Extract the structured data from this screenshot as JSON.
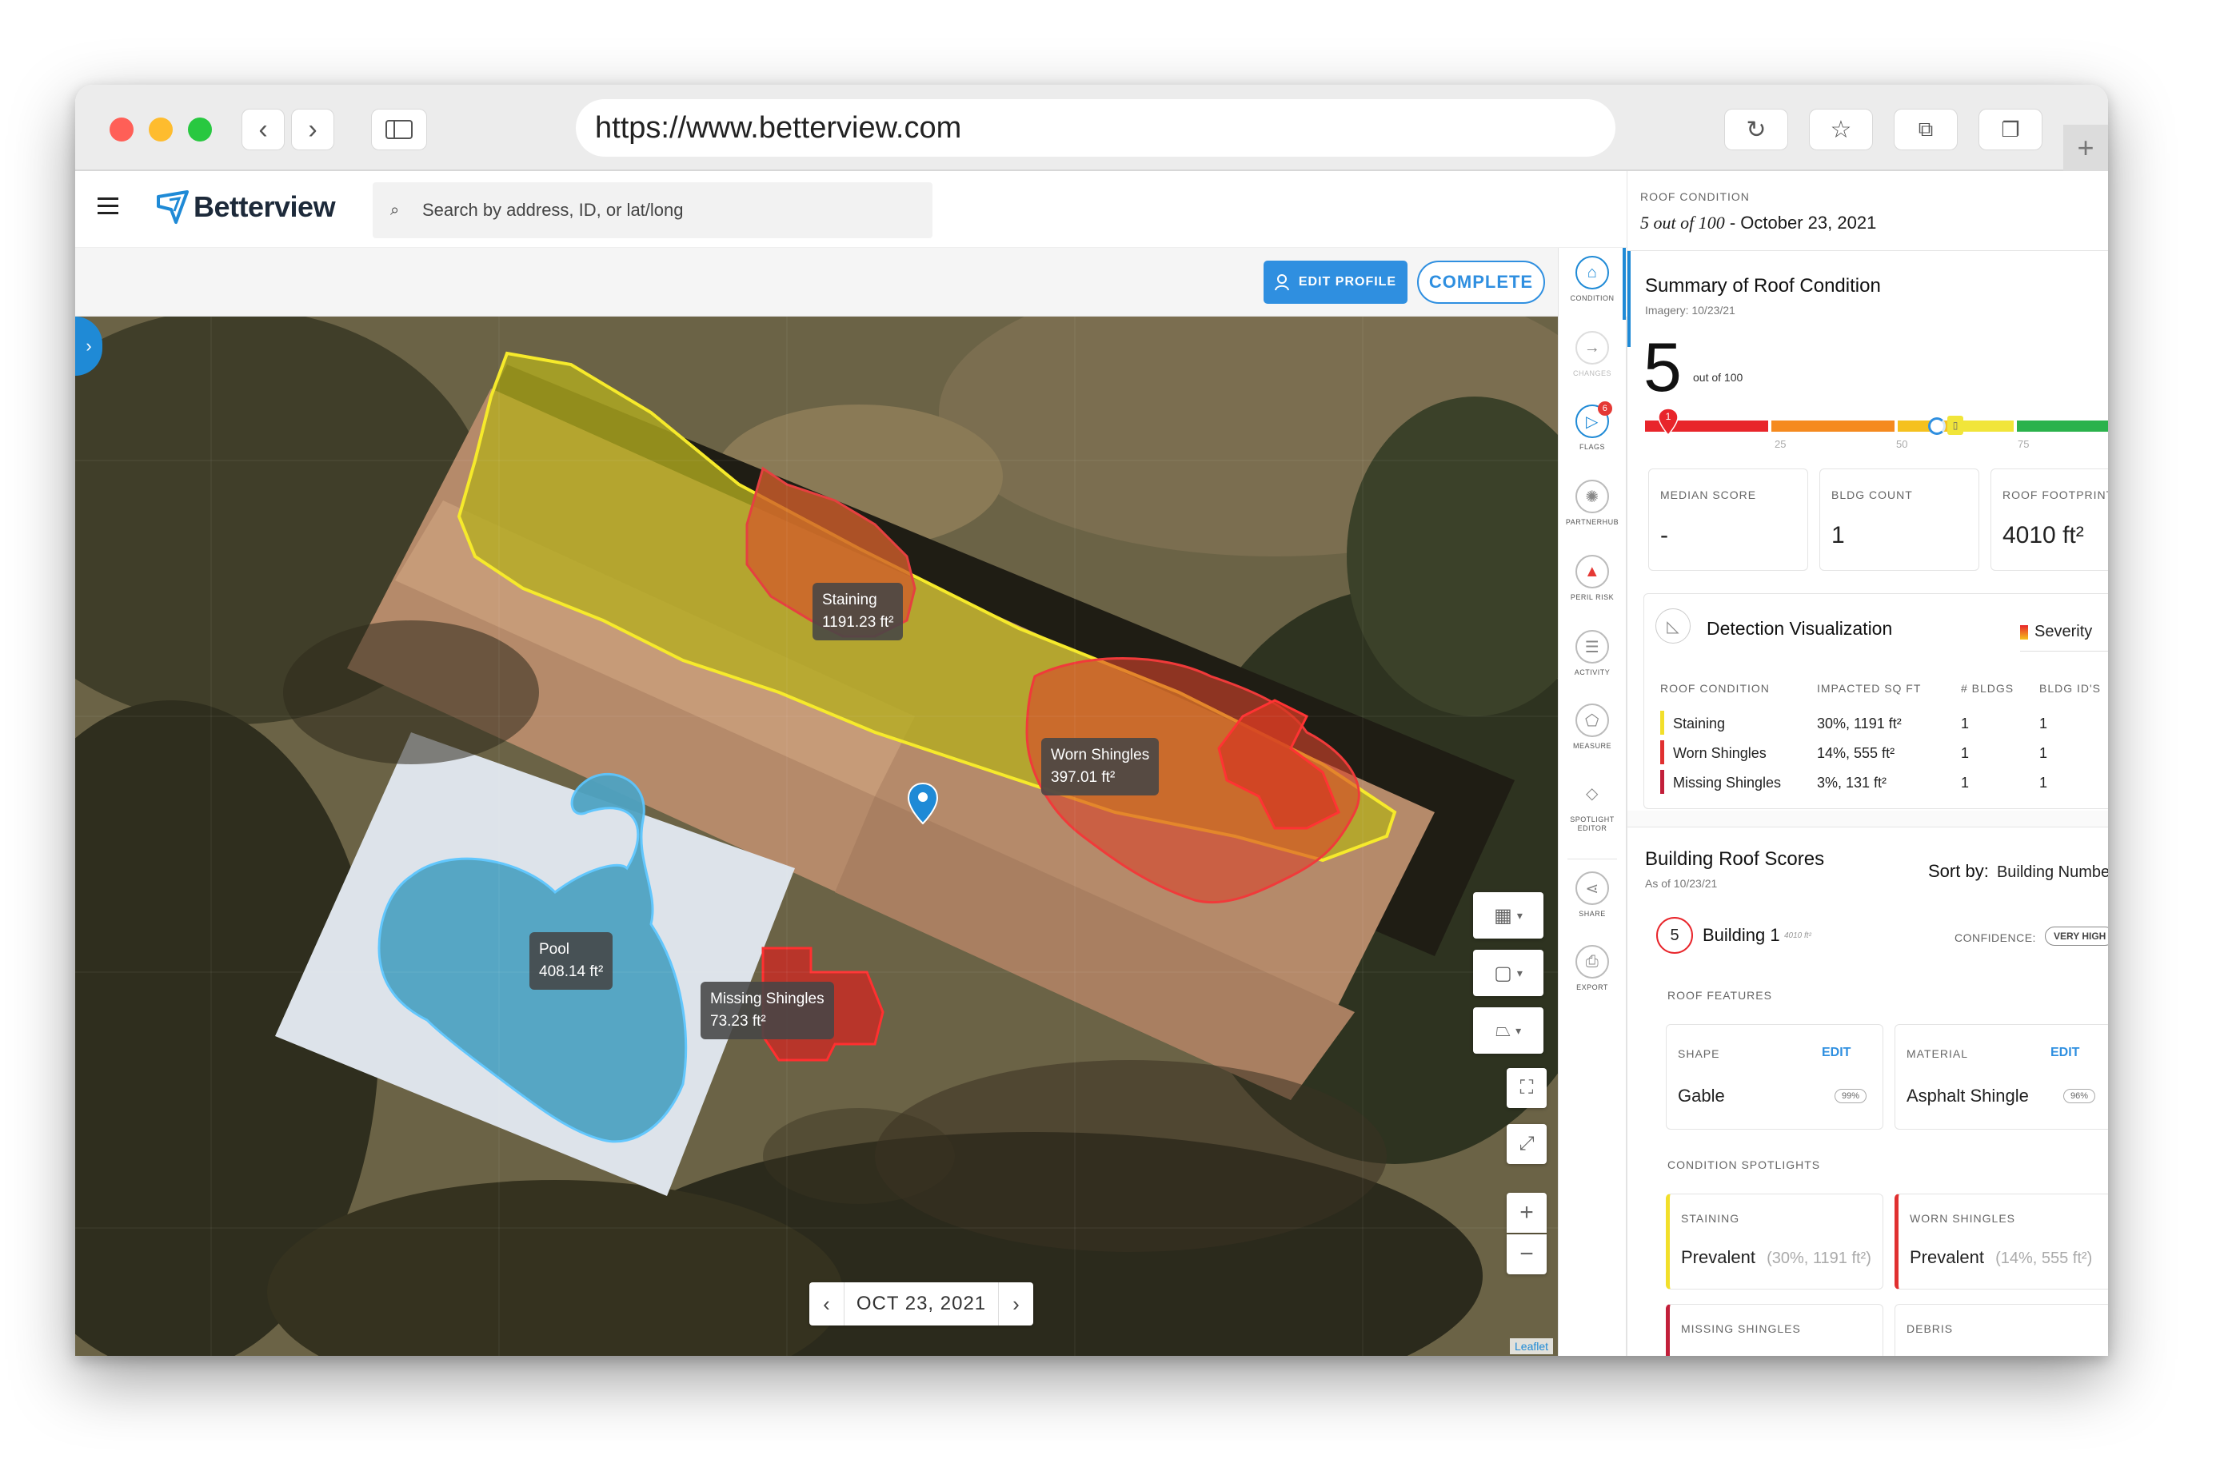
{
  "browser": {
    "url": "https://www.betterview.com"
  },
  "topnav": {
    "brand": "Betterview",
    "search_placeholder": "Search by address, ID, or lat/long"
  },
  "toolbar": {
    "edit_profile": "EDIT PROFILE",
    "complete": "COMPLETE"
  },
  "rail": {
    "items": [
      {
        "label": "CONDITION",
        "icon": "house-icon"
      },
      {
        "label": "CHANGES",
        "icon": "arrow-right-icon"
      },
      {
        "label": "FLAGS",
        "icon": "flag-icon",
        "badge": "6"
      },
      {
        "label": "PARTNERHUB",
        "icon": "partnerhub-icon"
      },
      {
        "label": "PERIL RISK",
        "icon": "warning-icon"
      },
      {
        "label": "ACTIVITY",
        "icon": "list-icon"
      },
      {
        "label": "MEASURE",
        "icon": "measure-icon"
      },
      {
        "label": "SPOTLIGHT EDITOR",
        "icon": "spotlight-icon"
      },
      {
        "label": "SHARE",
        "icon": "share-icon"
      },
      {
        "label": "EXPORT",
        "icon": "export-icon"
      }
    ]
  },
  "map": {
    "date": "OCT 23, 2021",
    "attribution": "Leaflet",
    "annotations": [
      {
        "name": "Staining",
        "area": "1191.23 ft²"
      },
      {
        "name": "Worn Shingles",
        "area": "397.01 ft²"
      },
      {
        "name": "Pool",
        "area": "408.14 ft²"
      },
      {
        "name": "Missing Shingles",
        "area": "73.23 ft²"
      }
    ]
  },
  "panel": {
    "header_label": "ROOF CONDITION",
    "header_score": "5 out of 100",
    "header_date": "October 23, 2021",
    "summary_title": "Summary of Roof Condition",
    "imagery": "Imagery: 10/23/21",
    "score": "5",
    "score_suffix": "out of 100",
    "score_marker": "1",
    "score_value_percent": 5,
    "ticks": [
      "25",
      "50",
      "75"
    ],
    "stats": [
      {
        "label": "MEDIAN SCORE",
        "value": "-"
      },
      {
        "label": "BLDG COUNT",
        "value": "1"
      },
      {
        "label": "ROOF FOOTPRINT",
        "value": "4010 ft²"
      }
    ],
    "detection": {
      "title": "Detection Visualization",
      "legend": "Severity",
      "headers": [
        "ROOF CONDITION",
        "IMPACTED SQ FT",
        "# BLDGS",
        "BLDG ID'S"
      ],
      "rows": [
        {
          "condition": "Staining",
          "impacted": "30%, 1191 ft²",
          "bldgs": "1",
          "ids": "1",
          "color": "#f2df2a"
        },
        {
          "condition": "Worn Shingles",
          "impacted": "14%, 555 ft²",
          "bldgs": "1",
          "ids": "1",
          "color": "#e03030"
        },
        {
          "condition": "Missing Shingles",
          "impacted": "3%, 131 ft²",
          "bldgs": "1",
          "ids": "1",
          "color": "#c21f3a"
        }
      ]
    },
    "building_scores": {
      "title": "Building Roof Scores",
      "as_of": "As of 10/23/21",
      "sort_label": "Sort by:",
      "sort_value": "Building Number",
      "building_score": "5",
      "building_name": "Building 1",
      "building_area": "4010 ft²",
      "confidence_label": "CONFIDENCE:",
      "confidence_value": "VERY HIGH"
    },
    "roof_features": {
      "title": "ROOF FEATURES",
      "items": [
        {
          "label": "SHAPE",
          "edit": "EDIT",
          "value": "Gable",
          "pct": "99%"
        },
        {
          "label": "MATERIAL",
          "edit": "EDIT",
          "value": "Asphalt Shingle",
          "pct": "96%"
        }
      ]
    },
    "spotlights": {
      "title": "CONDITION SPOTLIGHTS",
      "items": [
        {
          "label": "STAINING",
          "value": "Prevalent",
          "detail": "(30%, 1191 ft²)",
          "color": "#f2df2a"
        },
        {
          "label": "WORN SHINGLES",
          "value": "Prevalent",
          "detail": "(14%, 555 ft²)",
          "color": "#e03030"
        },
        {
          "label": "MISSING SHINGLES",
          "value": "",
          "detail": "",
          "color": "#c21f3a"
        },
        {
          "label": "DEBRIS",
          "value": "",
          "detail": "",
          "color": "#e03030"
        }
      ]
    }
  }
}
